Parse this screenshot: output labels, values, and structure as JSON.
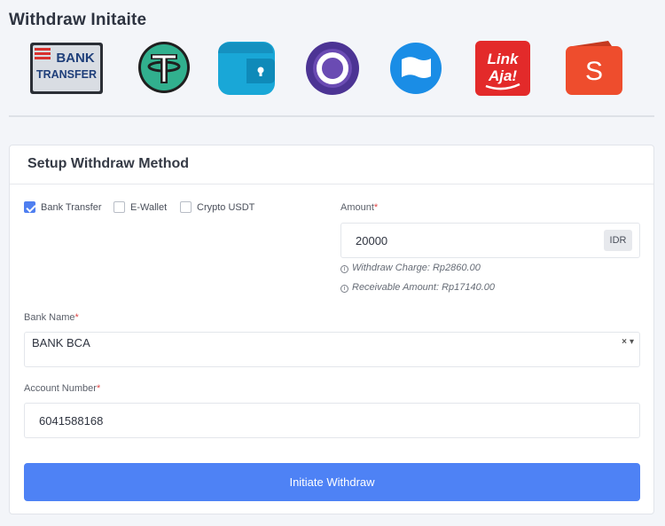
{
  "page": {
    "title": "Withdraw Initaite"
  },
  "methods": [
    {
      "name": "bank-transfer-logo",
      "text_top": "BANK",
      "text_bottom": "TRANSFER"
    },
    {
      "name": "tether-logo"
    },
    {
      "name": "wallet-logo"
    },
    {
      "name": "ovo-logo"
    },
    {
      "name": "dana-logo"
    },
    {
      "name": "linkaja-logo",
      "text_top": "Link",
      "text_bottom": "Aja!"
    },
    {
      "name": "shopeepay-logo",
      "text": "S"
    }
  ],
  "card": {
    "title": "Setup Withdraw Method"
  },
  "method_options": [
    {
      "label": "Bank Transfer",
      "checked": true
    },
    {
      "label": "E-Wallet",
      "checked": false
    },
    {
      "label": "Crypto USDT",
      "checked": false
    }
  ],
  "amount": {
    "label": "Amount",
    "required_mark": "*",
    "value": "20000",
    "currency": "IDR",
    "charge_text": "Withdraw Charge: Rp2860.00",
    "receivable_text": "Receivable Amount: Rp17140.00"
  },
  "bank": {
    "label": "Bank Name",
    "required_mark": "*",
    "value": "BANK BCA",
    "clear_glyph": "×",
    "arrow_glyph": "▾"
  },
  "account": {
    "label": "Account Number",
    "required_mark": "*",
    "value": "6041588168"
  },
  "submit": {
    "label": "Initiate Withdraw"
  },
  "colors": {
    "accent": "#4e82f5",
    "required": "#e04848",
    "page_bg": "#f3f5f9"
  }
}
